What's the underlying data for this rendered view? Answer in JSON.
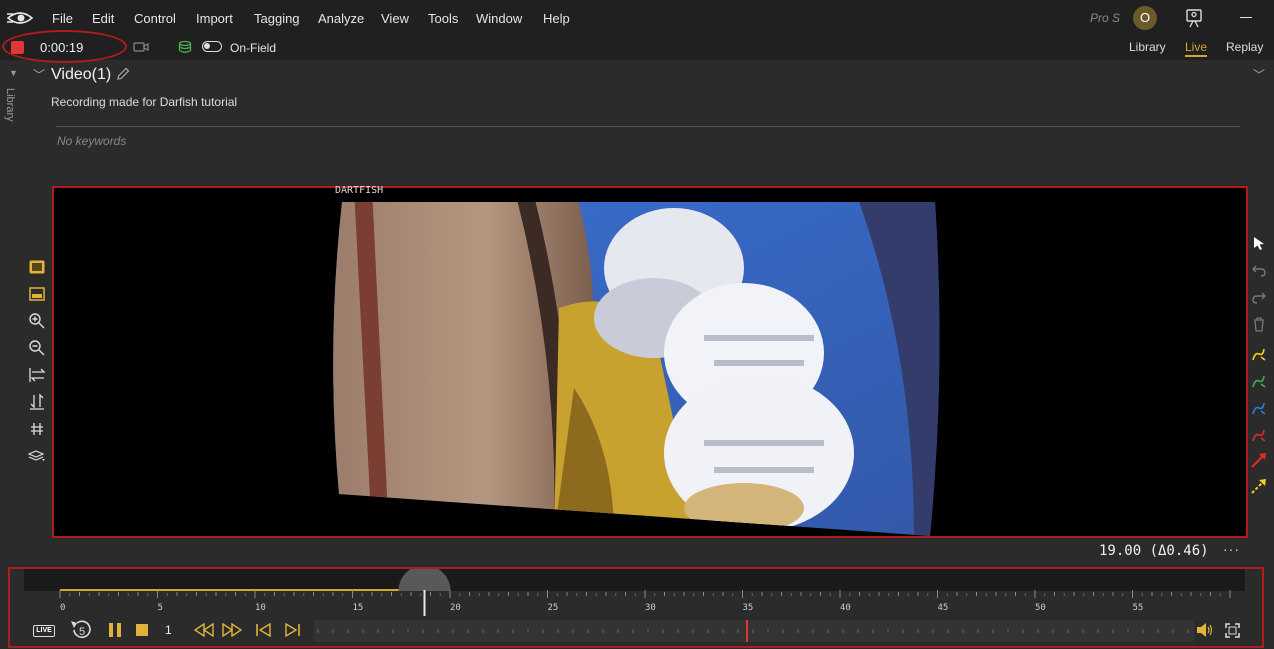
{
  "menu": {
    "items": [
      "File",
      "Edit",
      "Control",
      "Import",
      "Tagging",
      "Analyze",
      "View",
      "Tools",
      "Window",
      "Help"
    ],
    "edition": "Pro S",
    "avatar_initial": "O"
  },
  "toolbar": {
    "record_time": "0:00:19",
    "on_field_label": "On-Field",
    "tabs": [
      "Library",
      "Live",
      "Replay"
    ],
    "active_tab": "Live"
  },
  "sidebar": {
    "label": "Library"
  },
  "video": {
    "title": "Video(1)",
    "description": "Recording made for Darfish tutorial",
    "keywords_placeholder": "No keywords",
    "watermark": "DARTFISH",
    "timecode": "19.00 (Δ0.46)",
    "more": "···"
  },
  "timeline": {
    "ruler_labels": [
      "0",
      "5",
      "10",
      "15",
      "20",
      "25",
      "30",
      "35",
      "40",
      "45",
      "50",
      "55"
    ],
    "playhead_seconds": 19,
    "live_badge": "LIVE",
    "replay_seconds": "5",
    "speed": "1"
  },
  "colors": {
    "accent": "#d4a72c",
    "record": "#e23535",
    "highlight_border": "#b01c1c",
    "menubar": "#202020",
    "background": "#2b2b2b"
  },
  "icons": {
    "left_tools": [
      "fit-frame-icon",
      "aspect-icon",
      "zoom-in-icon",
      "zoom-out-icon",
      "flip-horizontal-icon",
      "flip-vertical-icon",
      "grid-icon",
      "layers-icon"
    ],
    "right_tools": [
      "pointer-icon",
      "undo-icon",
      "redo-icon",
      "delete-icon",
      "pen-yellow-icon",
      "pen-green-icon",
      "pen-blue-icon",
      "pen-red-icon",
      "arrow-red-icon",
      "arrow-yellow-icon"
    ]
  }
}
